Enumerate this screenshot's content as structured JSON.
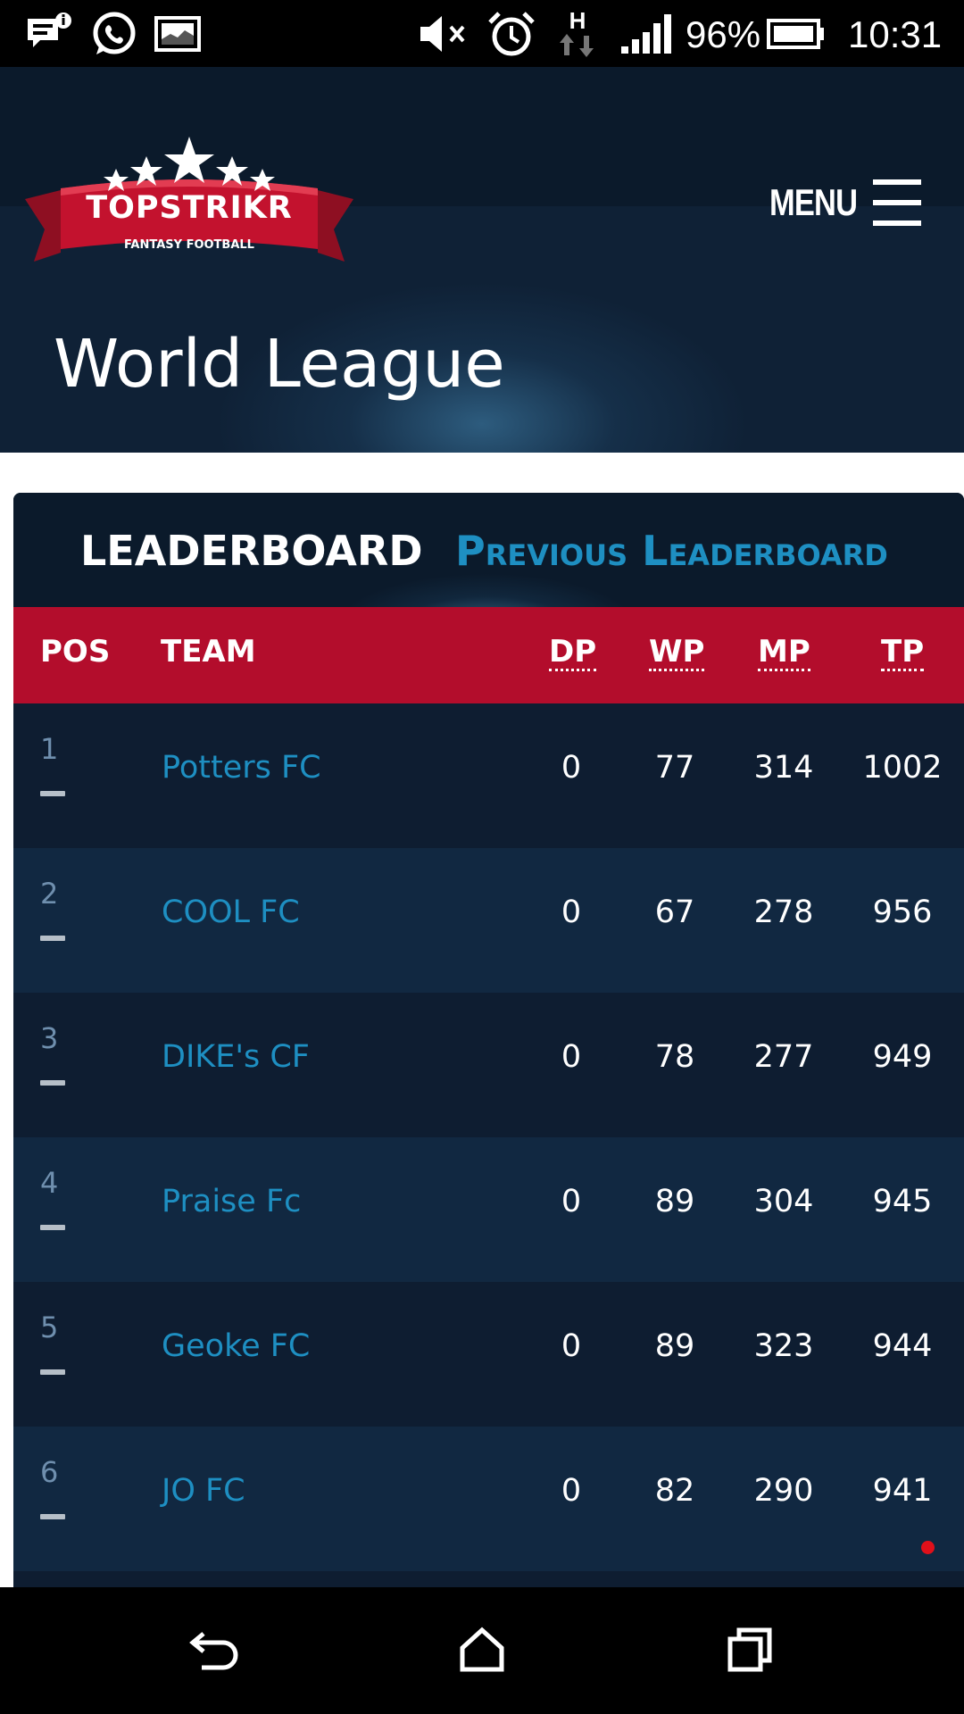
{
  "status_bar": {
    "battery": "96%",
    "time": "10:31",
    "network_type": "H",
    "icons": [
      "message-alert-icon",
      "whatsapp-icon",
      "gallery-icon",
      "mute-icon",
      "alarm-icon",
      "network-data-icon",
      "signal-icon",
      "battery-icon"
    ]
  },
  "header": {
    "brand": "TOPSTRIKR",
    "tagline": "FANTASY FOOTBALL",
    "menu_label": "MENU",
    "page_title": "World League"
  },
  "leaderboard": {
    "tab_active": "LEADERBOARD",
    "tab_previous": "Previous Leaderboard",
    "columns": [
      "POS",
      "TEAM",
      "DP",
      "WP",
      "MP",
      "TP"
    ],
    "rows": [
      {
        "pos": "1",
        "team": "Potters FC",
        "dp": "0",
        "wp": "77",
        "mp": "314",
        "tp": "1002"
      },
      {
        "pos": "2",
        "team": "COOL FC",
        "dp": "0",
        "wp": "67",
        "mp": "278",
        "tp": "956"
      },
      {
        "pos": "3",
        "team": "DIKE's CF",
        "dp": "0",
        "wp": "78",
        "mp": "277",
        "tp": "949"
      },
      {
        "pos": "4",
        "team": "Praise Fc",
        "dp": "0",
        "wp": "89",
        "mp": "304",
        "tp": "945"
      },
      {
        "pos": "5",
        "team": "Geoke FC",
        "dp": "0",
        "wp": "89",
        "mp": "323",
        "tp": "944"
      },
      {
        "pos": "6",
        "team": "JO FC",
        "dp": "0",
        "wp": "82",
        "mp": "290",
        "tp": "941"
      }
    ]
  },
  "colors": {
    "header_bg": "#0f2136",
    "table_header_bg": "#b30d2c",
    "link_blue": "#1e8fc2",
    "row_odd": "#0e1d31",
    "row_even": "#112841"
  },
  "nav_bar": {
    "icons": [
      "back-icon",
      "home-icon",
      "recents-icon"
    ]
  }
}
